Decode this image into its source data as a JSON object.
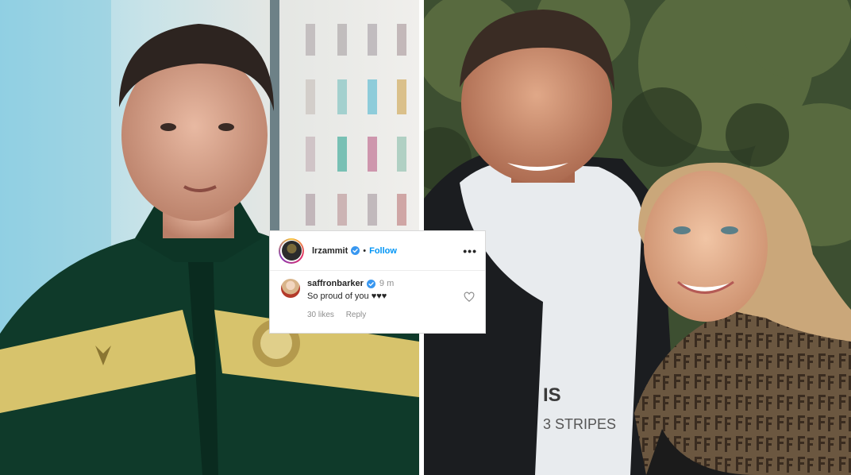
{
  "comment_card": {
    "post_author": {
      "username": "lrzammit",
      "verified": true,
      "separator": "•",
      "follow_label": "Follow",
      "more_icon": "more-horizontal-icon",
      "more_label": "•••"
    },
    "comment": {
      "username": "saffronbarker",
      "verified": true,
      "time": "9 m",
      "text": "So proud of you ♥♥♥",
      "likes": "30 likes",
      "reply_label": "Reply",
      "like_icon": "heart-outline-icon"
    },
    "colors": {
      "link_blue": "#0095f6",
      "verified_blue": "#3897f0",
      "text": "#262626",
      "secondary_text": "#8e8e8e"
    }
  }
}
